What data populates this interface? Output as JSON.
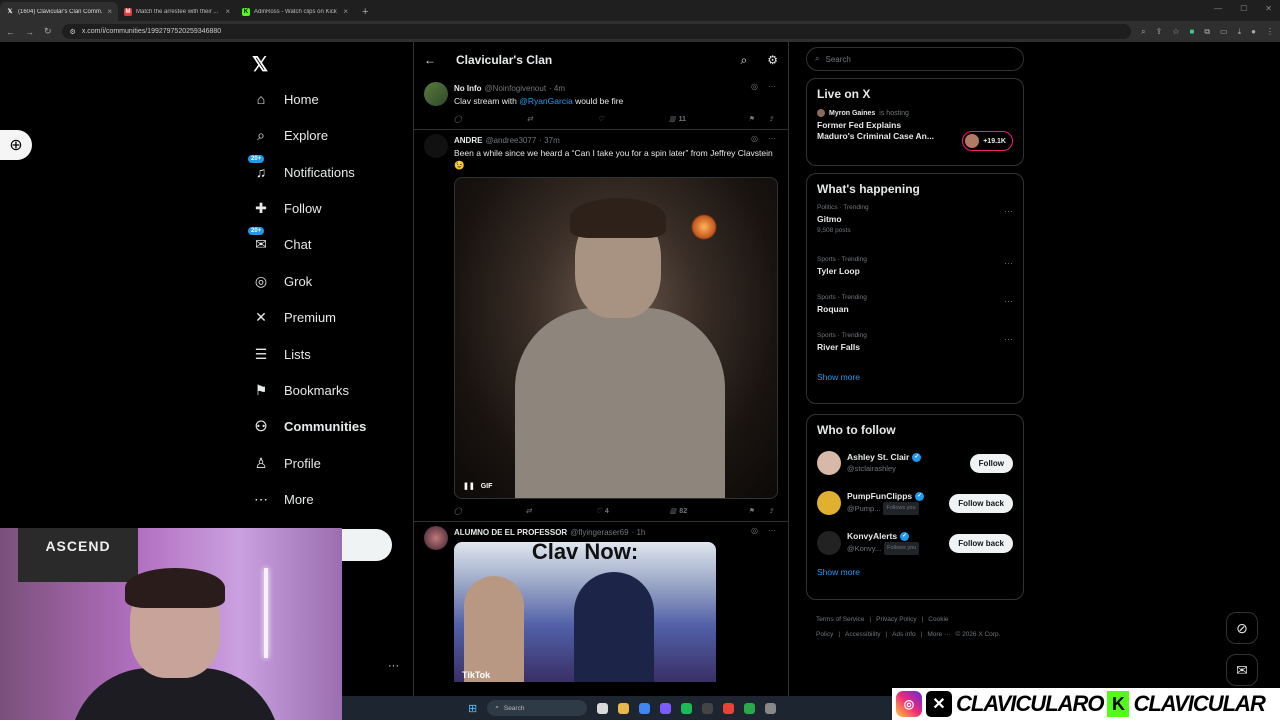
{
  "browser": {
    "tabs": [
      {
        "label": "(1604) Clavicular's Clan Comm...",
        "fav": "X",
        "fav_color": "#ffffff",
        "active": true
      },
      {
        "label": "Match the arrestee with their ...",
        "fav": "M",
        "fav_color": "#e03a3a",
        "active": false
      },
      {
        "label": "AdinRoss - Watch clips on Kick",
        "fav": "K",
        "fav_color": "#53fc18",
        "active": false
      }
    ],
    "url": "x.com/i/communities/1992797520259346880"
  },
  "nav": {
    "items": [
      {
        "label": "Home",
        "icon": "home-icon",
        "glyph": "⌂",
        "badge": ""
      },
      {
        "label": "Explore",
        "icon": "search-icon",
        "glyph": "⌕",
        "badge": ""
      },
      {
        "label": "Notifications",
        "icon": "bell-icon",
        "glyph": "♫",
        "badge": "20+"
      },
      {
        "label": "Follow",
        "icon": "add-person-icon",
        "glyph": "✚",
        "badge": ""
      },
      {
        "label": "Chat",
        "icon": "mail-icon",
        "glyph": "✉",
        "badge": "20+"
      },
      {
        "label": "Grok",
        "icon": "grok-icon",
        "glyph": "◎",
        "badge": ""
      },
      {
        "label": "Premium",
        "icon": "x-icon",
        "glyph": "✕",
        "badge": ""
      },
      {
        "label": "Lists",
        "icon": "list-icon",
        "glyph": "☰",
        "badge": ""
      },
      {
        "label": "Bookmarks",
        "icon": "bookmark-icon",
        "glyph": "⚑",
        "badge": ""
      },
      {
        "label": "Communities",
        "icon": "people-icon",
        "glyph": "⚇",
        "badge": "",
        "bold": true
      },
      {
        "label": "Profile",
        "icon": "person-icon",
        "glyph": "♙",
        "badge": ""
      },
      {
        "label": "More",
        "icon": "more-circle-icon",
        "glyph": "⋯",
        "badge": ""
      }
    ]
  },
  "main": {
    "title": "Clavicular's Clan",
    "posts": [
      {
        "name": "No Info",
        "handle": "@Noinfogivenout",
        "time": "· 4m",
        "text_before": "Clav stream with ",
        "mention": "@RyanGarcia",
        "text_after": " would be fire",
        "replies": "",
        "reposts": "",
        "likes": "",
        "views": "11"
      },
      {
        "name": "ANDRE",
        "handle": "@andree3077",
        "time": "· 37m",
        "text": "Been a while since we heard a “Can I take you for a spin later” from Jeffrey Clavstein 😉",
        "media_label": "GIF",
        "replies": "",
        "reposts": "",
        "likes": "4",
        "views": "82"
      },
      {
        "name": "ALUMNO DE EL PROFESSOR",
        "handle": "@flyingeraser69",
        "time": "· 1h",
        "media_caption": "Clav Now:",
        "media_watermark": "TikTok"
      }
    ]
  },
  "sidebar": {
    "search_placeholder": "Search",
    "live": {
      "title": "Live on X",
      "host": "Myron Gaines",
      "host_suffix": "is hosting",
      "space_title": "Former Fed Explains Maduro's Criminal Case An...",
      "listeners": "+19.1K"
    },
    "happening": {
      "title": "What's happening",
      "trends": [
        {
          "category": "Politics · Trending",
          "name": "Gitmo",
          "count": "9,508 posts"
        },
        {
          "category": "Sports · Trending",
          "name": "Tyler Loop",
          "count": ""
        },
        {
          "category": "Sports · Trending",
          "name": "Roquan",
          "count": ""
        },
        {
          "category": "Sports · Trending",
          "name": "River Falls",
          "count": ""
        }
      ],
      "show_more": "Show more"
    },
    "who_to_follow": {
      "title": "Who to follow",
      "users": [
        {
          "name": "Ashley St. Clair",
          "handle": "@stclairashley",
          "follows_you": "",
          "button": "Follow",
          "avatar_color": "#d8b8a8"
        },
        {
          "name": "PumpFunClipps",
          "handle": "@Pump...",
          "follows_you": "Follows you",
          "button": "Follow back",
          "avatar_color": "#e0b030"
        },
        {
          "name": "KonvyAlerts",
          "handle": "@Konvy...",
          "follows_you": "Follows you",
          "button": "Follow back",
          "avatar_color": "#222222"
        }
      ],
      "show_more": "Show more"
    },
    "footer": [
      "Terms of Service",
      "|",
      "Privacy Policy",
      "|",
      "Cookie Policy",
      "|",
      "Accessibility",
      "|",
      "Ads info",
      "|",
      "More ···",
      "© 2026 X Corp."
    ]
  },
  "webcam": {
    "poster_text": "ASCEND"
  },
  "taskbar": {
    "search_label": "Search"
  },
  "banner": {
    "text": "CLAVICULARO",
    "text2": "CLAVICULAR"
  },
  "colors": {
    "accent": "#1d9bf0",
    "background": "#000000",
    "border": "#2f3336",
    "muted": "#71767b"
  }
}
